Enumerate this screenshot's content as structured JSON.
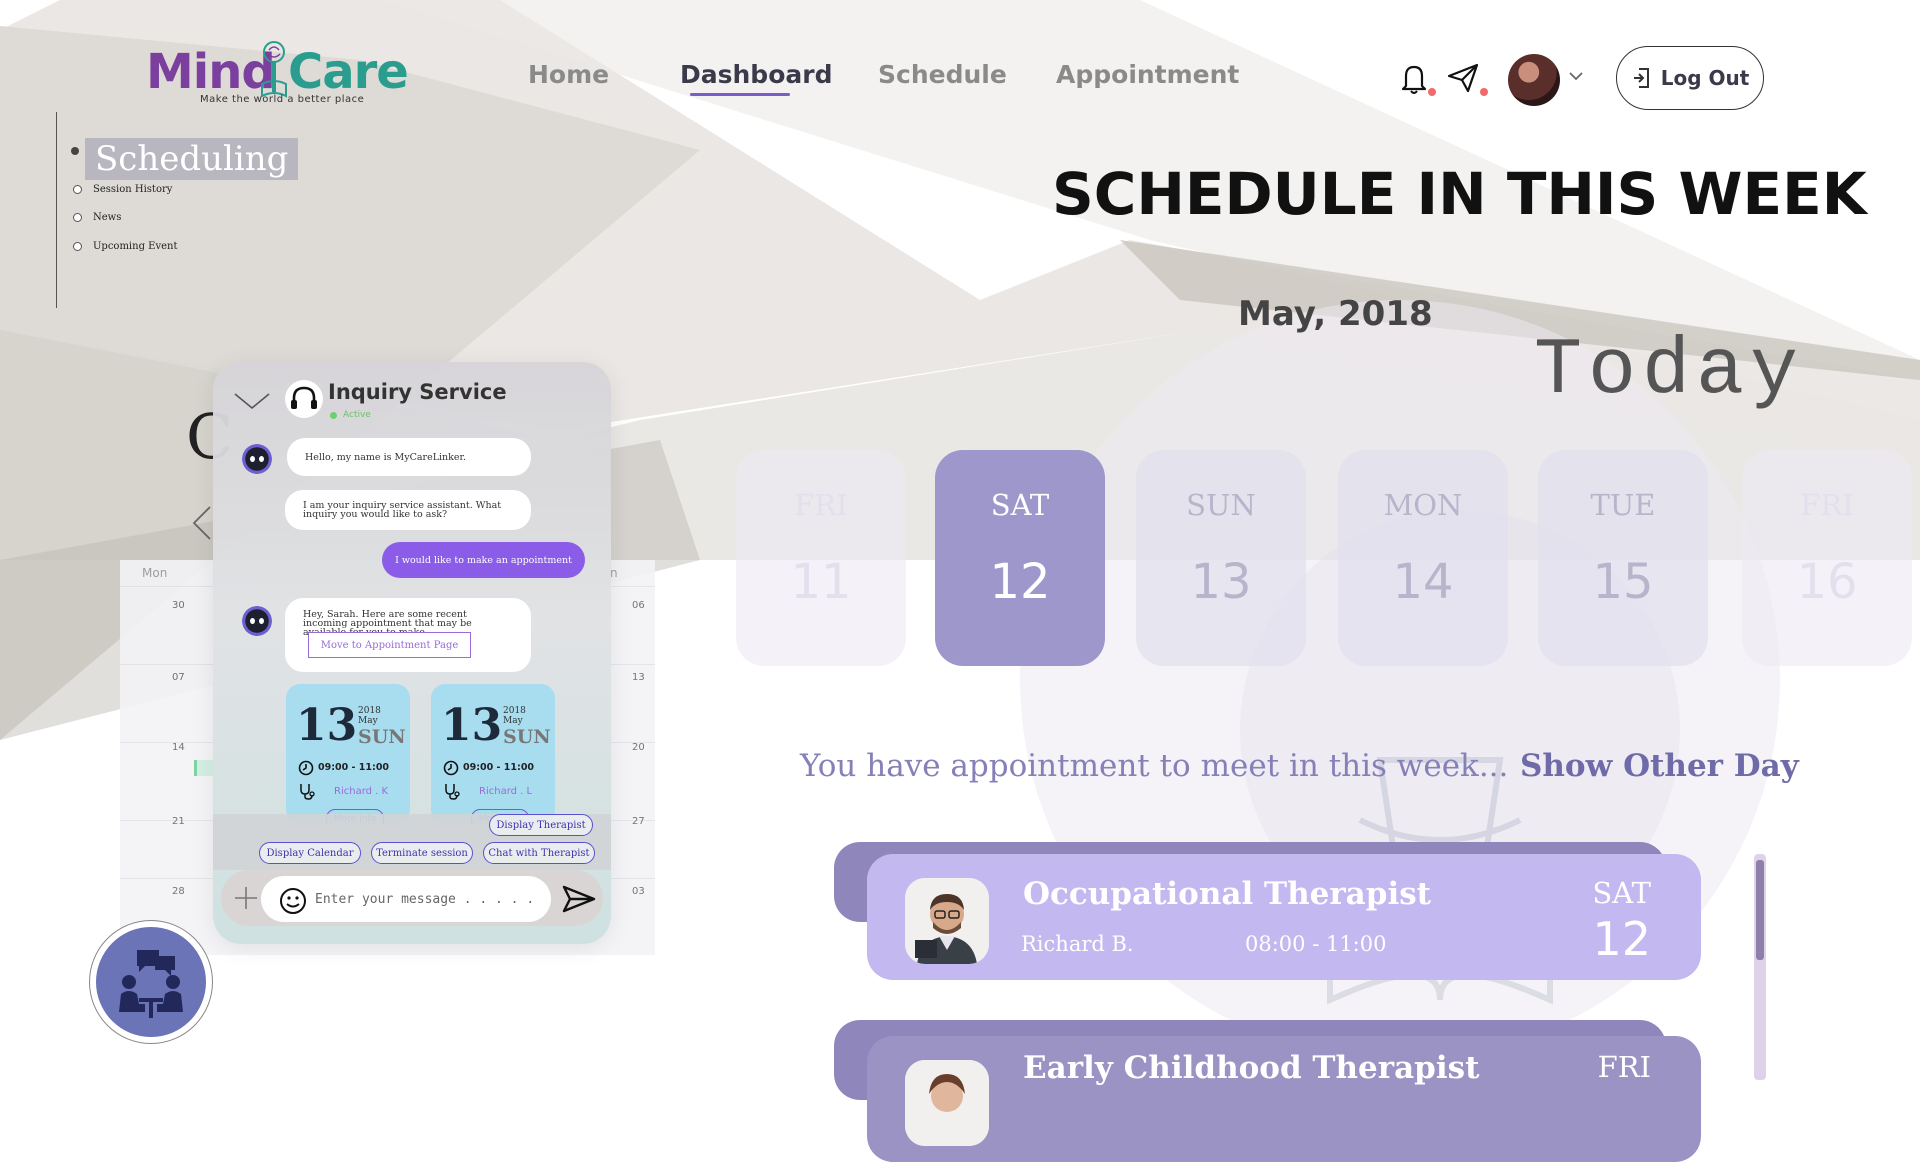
{
  "brand": {
    "name_part1": "Mind",
    "name_part2": "Care",
    "tagline": "Make the world a better place",
    "colors": {
      "mind": "#7b3f9e",
      "care": "#2a9d8f"
    }
  },
  "nav": {
    "items": [
      {
        "label": "Home",
        "active": false
      },
      {
        "label": "Dashboard",
        "active": true
      },
      {
        "label": "Schedule",
        "active": false
      },
      {
        "label": "Appointment",
        "active": false
      }
    ]
  },
  "header": {
    "notification_icon": "bell-icon",
    "message_icon": "paper-plane-icon",
    "logout_label": "Log Out",
    "logout_icon": "logout-icon"
  },
  "sidemenu": {
    "main": "Scheduling",
    "items": [
      "Session History",
      "News",
      "Upcoming Event"
    ]
  },
  "calendar": {
    "head_left": "Mon",
    "head_right": "n",
    "left_col": [
      "30",
      "07",
      "14",
      "21",
      "28"
    ],
    "right_col": [
      "06",
      "13",
      "20",
      "27",
      "03"
    ],
    "partial_letter": "C"
  },
  "chat": {
    "title": "Inquiry Service",
    "status": "Active",
    "messages": [
      "Hello, my name is MyCareLinker.",
      "I am your inquiry service assistant. What inquiry you would like to ask?",
      "Hey, Sarah. Here are some recent incoming appointment that may be available for you to make."
    ],
    "user_message": "I would like to make an appointment",
    "move_button": "Move to Appointment Page",
    "cards": [
      {
        "day": "13",
        "year": "2018",
        "month": "May",
        "dow": "SUN",
        "time": "09:00 - 11:00",
        "name": "Richard . K",
        "more": "More Info"
      },
      {
        "day": "13",
        "year": "2018",
        "month": "May",
        "dow": "SUN",
        "time": "09:00 - 11:00",
        "name": "Richard . L",
        "more": "More Info"
      }
    ],
    "quick_buttons": [
      "Display Therapist",
      "Display Calendar",
      "Terminate session",
      "Chat with Therapist"
    ],
    "input_placeholder": "Enter your message . . . . ."
  },
  "schedule": {
    "title": "SCHEDULE IN THIS WEEK",
    "month": "May, 2018",
    "today": "Today",
    "days": [
      {
        "dow": "FRI",
        "num": "11",
        "state": "faint"
      },
      {
        "dow": "SAT",
        "num": "12",
        "state": "active"
      },
      {
        "dow": "SUN",
        "num": "13",
        "state": "normal"
      },
      {
        "dow": "MON",
        "num": "14",
        "state": "normal"
      },
      {
        "dow": "TUE",
        "num": "15",
        "state": "normal"
      },
      {
        "dow": "FRI",
        "num": "16",
        "state": "faint"
      }
    ],
    "week_message": "You have appointment to meet in this week...",
    "show_other_day": "Show Other Day",
    "appointments": [
      {
        "type": "Occupational Therapist",
        "person": "Richard B.",
        "time": "08:00 - 11:00",
        "dow": "SAT",
        "num": "12"
      },
      {
        "type": "Early Childhood Therapist",
        "dow": "FRI"
      }
    ]
  }
}
